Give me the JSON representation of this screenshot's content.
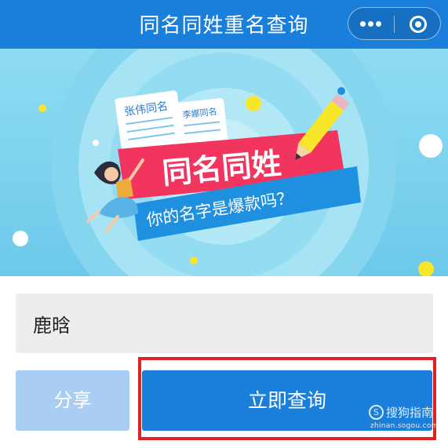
{
  "header": {
    "title": "同名同姓重名查询"
  },
  "capsule": {
    "more_icon": "more-dots-icon",
    "close_icon": "target-close-icon"
  },
  "banner": {
    "headline": "同名同姓",
    "tagline": "你的名字是爆款吗？",
    "card1_text": "张伟同名",
    "card2_text": "李娜同名",
    "colors": {
      "background": "#7fd4ee",
      "headline_ribbon": "#f2355e",
      "tagline_ribbon": "#1f8fe0",
      "accent": "#f7e62a"
    }
  },
  "form": {
    "name_value": "鹿晗",
    "share_label": "分享",
    "query_label": "立即查询"
  },
  "watermark": {
    "text": "搜狗指南",
    "url": "zhinan.sogou.com",
    "icon_letter": "S"
  },
  "colors": {
    "primary": "#1a7fdb",
    "share_disabled": "#a9cdf3",
    "highlight": "#e02227"
  }
}
